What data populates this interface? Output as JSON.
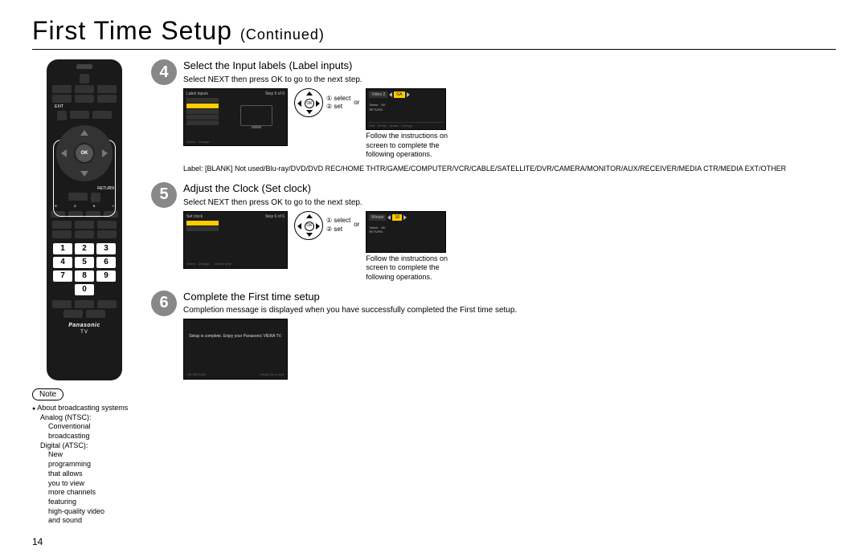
{
  "page": {
    "title": "First Time Setup",
    "continued": "(Continued)",
    "number": "14"
  },
  "remote": {
    "ok": "OK",
    "exit": "EXIT",
    "return": "RETURN",
    "color_r": "R",
    "color_g": "G",
    "color_b": "B",
    "color_y": "Y",
    "keys": {
      "1": "1",
      "2": "2",
      "3": "3",
      "4": "4",
      "5": "5",
      "6": "6",
      "7": "7",
      "8": "8",
      "9": "9",
      "0": "0"
    },
    "brand": "Panasonic",
    "tv": "TV"
  },
  "steps": {
    "s4": {
      "num": "4",
      "title": "Select the Input labels (Label inputs)",
      "sub": "Select NEXT then press OK to go to the next step.",
      "screen_hdr_left": "Label inputs",
      "screen_hdr_right": "Step 5 of 6",
      "dpad_ok": "OK",
      "sel1": "① select",
      "sel2": "② set",
      "or": "or",
      "popup_field": "Video 2",
      "popup_val": "GA",
      "popup_select": "Select",
      "popup_ok": "OK",
      "popup_return": "RETURN",
      "follow": "Follow the instructions on screen to complete the following operations.",
      "label_line": "Label: [BLANK] Not used/Blu-ray/DVD/DVD REC/HOME THTR/GAME/COMPUTER/VCR/CABLE/SATELLITE/DVR/CAMERA/MONITOR/AUX/RECEIVER/MEDIA CTR/MEDIA EXT/OTHER"
    },
    "s5": {
      "num": "5",
      "title": "Adjust the Clock (Set clock)",
      "sub": "Select NEXT then press OK to go to the next step.",
      "screen_hdr_left": "Set clock",
      "screen_hdr_right": "Step 6 of 6",
      "dpad_ok": "OK",
      "sel1": "① select",
      "sel2": "② set",
      "or": "or",
      "popup_field": "Minute",
      "popup_val": "10",
      "popup_select": "Select",
      "popup_ok": "OK",
      "popup_return": "RETURN",
      "follow": "Follow the instructions on screen to complete the following operations."
    },
    "s6": {
      "num": "6",
      "title": "Complete the First time setup",
      "sub": "Completion message is displayed when you have successfully completed the First time setup.",
      "screen_msg": "Setup is complete. Enjoy your Panasonic VIERA TV.",
      "ftr_ok": "OK",
      "ftr_return": "RETURN",
      "ftr_right": "Press OK to exit"
    }
  },
  "note": {
    "hdr": "Note",
    "bullet": "About broadcasting systems",
    "analog": "Analog (NTSC):",
    "analog_desc1": "Conventional",
    "analog_desc2": "broadcasting",
    "digital": "Digital (ATSC):",
    "digital_desc1": "New",
    "digital_desc2": "programming",
    "digital_desc3": "that allows",
    "digital_desc4": "you to view",
    "digital_desc5": "more channels",
    "digital_desc6": "featuring",
    "digital_desc7": "high-quality video",
    "digital_desc8": "and sound"
  }
}
